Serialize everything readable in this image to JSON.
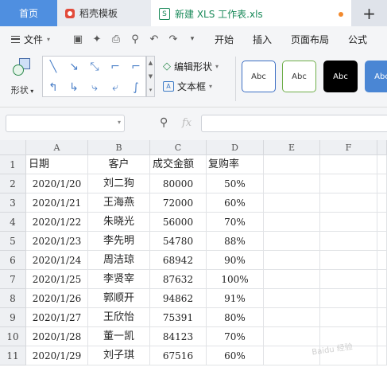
{
  "tabs": {
    "home": "首页",
    "templates": "稻壳模板",
    "file": "新建 XLS 工作表.xls",
    "add": "+"
  },
  "menu": {
    "file": "文件",
    "items": [
      "开始",
      "插入",
      "页面布局",
      "公式"
    ]
  },
  "ribbon": {
    "shape_label": "形状",
    "edit_shape": "编辑形状",
    "textbox": "文本框",
    "style_samples": [
      "Abc",
      "Abc",
      "Abc",
      "Abc"
    ]
  },
  "formula_bar": {
    "fx": "fx",
    "cell_ref": "",
    "formula": ""
  },
  "sheet": {
    "columns": [
      "A",
      "B",
      "C",
      "D",
      "E",
      "F"
    ],
    "rows": [
      "1",
      "2",
      "3",
      "4",
      "5",
      "6",
      "7",
      "8",
      "9",
      "10",
      "11"
    ],
    "header": [
      "日期",
      "客户",
      "成交金额",
      "复购率"
    ],
    "data": [
      [
        "2020/1/20",
        "刘二狗",
        "80000",
        "50%"
      ],
      [
        "2020/1/21",
        "王海燕",
        "72000",
        "60%"
      ],
      [
        "2020/1/22",
        "朱晓光",
        "56000",
        "70%"
      ],
      [
        "2020/1/23",
        "李先明",
        "54780",
        "88%"
      ],
      [
        "2020/1/24",
        "周洁琼",
        "68942",
        "90%"
      ],
      [
        "2020/1/25",
        "李贤宰",
        "87632",
        "100%"
      ],
      [
        "2020/1/26",
        "郭顺开",
        "94862",
        "91%"
      ],
      [
        "2020/1/27",
        "王欣怡",
        "75391",
        "80%"
      ],
      [
        "2020/1/28",
        "董一凯",
        "84123",
        "70%"
      ],
      [
        "2020/1/29",
        "刘子琪",
        "67516",
        "60%"
      ]
    ]
  },
  "colors": {
    "home_tab": "#4f8fe0",
    "file_tab_text": "#1a8a5a",
    "unsaved_dot": "#f28a2e"
  }
}
